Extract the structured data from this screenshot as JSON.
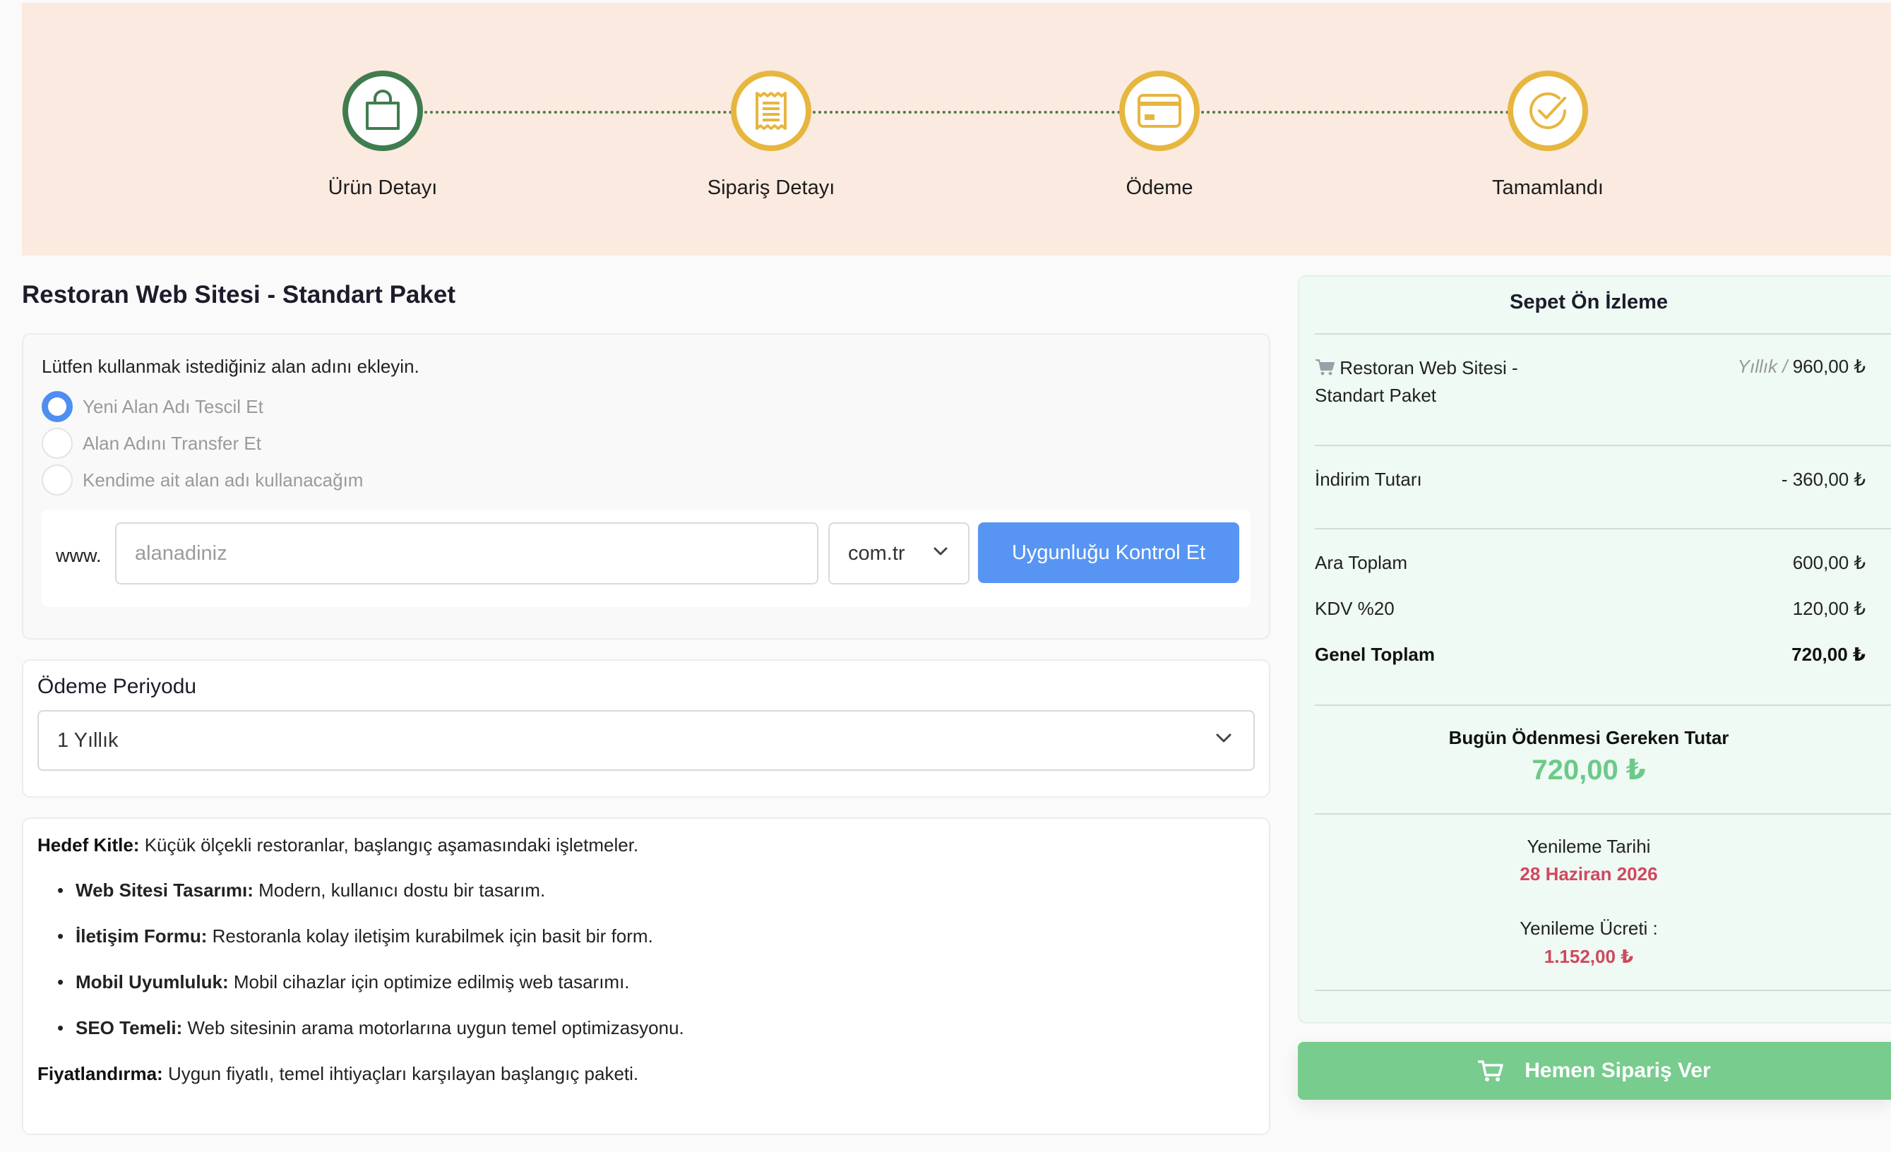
{
  "steps": [
    {
      "label": "Ürün Detayı"
    },
    {
      "label": "Sipariş Detayı"
    },
    {
      "label": "Ödeme"
    },
    {
      "label": "Tamamlandı"
    }
  ],
  "product": {
    "title": "Restoran Web Sitesi - Standart Paket"
  },
  "domain": {
    "hint": "Lütfen kullanmak istediğiniz alan adını ekleyin.",
    "options": [
      {
        "label": "Yeni Alan Adı Tescil Et",
        "selected": true
      },
      {
        "label": "Alan Adını Transfer Et",
        "selected": false
      },
      {
        "label": "Kendime ait alan adı kullanacağım",
        "selected": false
      }
    ],
    "prefix": "www.",
    "placeholder": "alanadiniz",
    "value": "",
    "tld": "com.tr",
    "check_label": "Uygunluğu Kontrol Et"
  },
  "period": {
    "label": "Ödeme Periyodu",
    "value": "1 Yıllık"
  },
  "description": {
    "audience_label": "Hedef Kitle:",
    "audience_text": " Küçük ölçekli restoranlar, başlangıç aşamasındaki işletmeler.",
    "features": [
      {
        "title": "Web Sitesi Tasarımı:",
        "text": " Modern, kullanıcı dostu bir tasarım."
      },
      {
        "title": "İletişim Formu:",
        "text": " Restoranla kolay iletişim kurabilmek için basit bir form."
      },
      {
        "title": "Mobil Uyumluluk:",
        "text": " Mobil cihazlar için optimize edilmiş web tasarımı."
      },
      {
        "title": "SEO Temeli:",
        "text": " Web sitesinin arama motorlarına uygun temel optimizasyonu."
      }
    ],
    "pricing_label": "Fiyatlandırma:",
    "pricing_text": " Uygun fiyatlı, temel ihtiyaçları karşılayan başlangıç paketi."
  },
  "cart": {
    "title": "Sepet Ön İzleme",
    "item_name_1": "Restoran Web Sitesi -",
    "item_name_2": "Standart Paket",
    "item_period": "Yıllık /",
    "item_price": "960,00 ₺",
    "discount_label": "İndirim Tutarı",
    "discount_value": "- 360,00 ₺",
    "subtotal_label": "Ara Toplam",
    "subtotal_value": "600,00 ₺",
    "vat_label": "KDV %20",
    "vat_value": "120,00 ₺",
    "total_label": "Genel Toplam",
    "total_value": "720,00 ₺",
    "due_label": "Bugün Ödenmesi Gereken Tutar",
    "due_value": "720,00 ₺",
    "renew_date_label": "Yenileme Tarihi",
    "renew_date_value": "28 Haziran 2026",
    "renew_fee_label": "Yenileme Ücreti :",
    "renew_fee_value": "1.152,00 ₺",
    "order_label": "Hemen Sipariş Ver"
  },
  "colors": {
    "accent_blue": "#5895f3",
    "green": "#77cc8e",
    "due_green": "#6cc98a",
    "renew_red": "#d0485f",
    "step_gold": "#e7b63f",
    "step_active": "#3f7d4f",
    "banner": "#fbeadf"
  }
}
